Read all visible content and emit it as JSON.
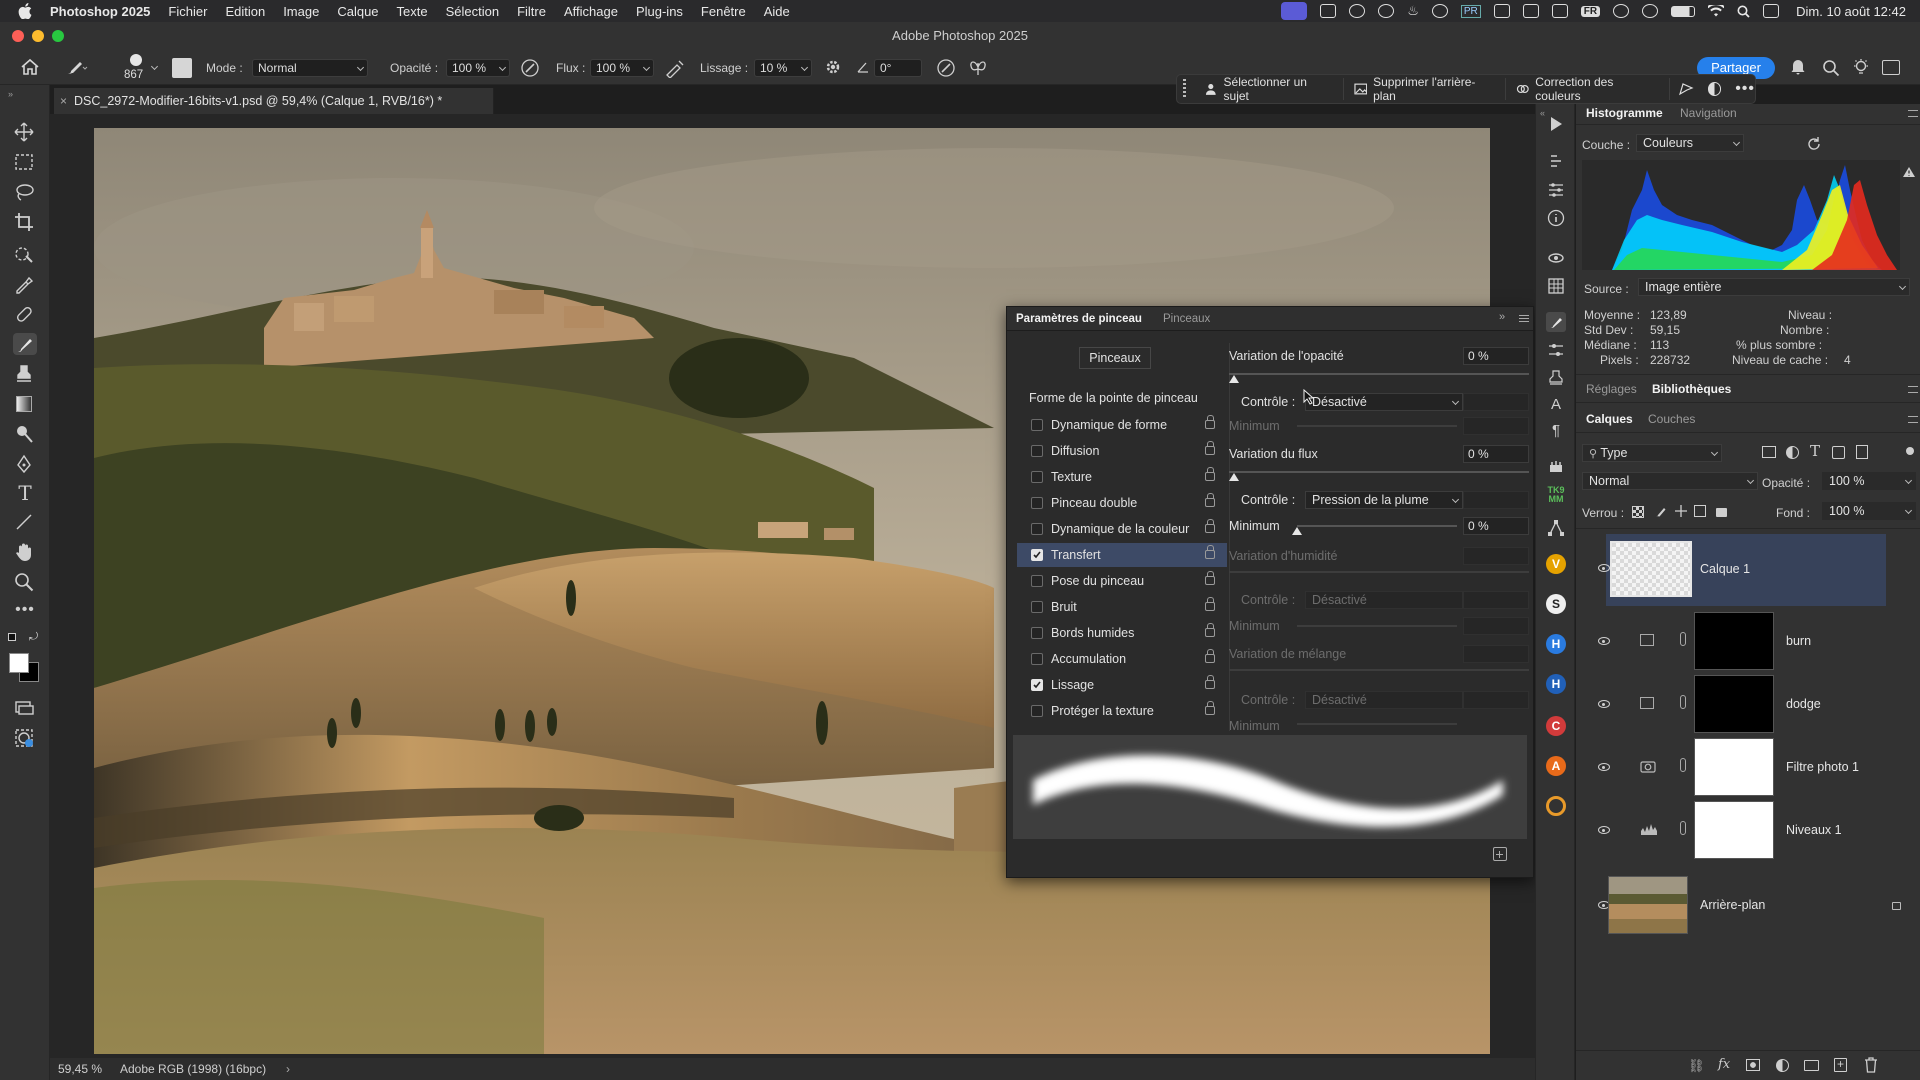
{
  "menubar": {
    "app": "Photoshop 2025",
    "items": [
      "Fichier",
      "Edition",
      "Image",
      "Calque",
      "Texte",
      "Sélection",
      "Filtre",
      "Affichage",
      "Plug-ins",
      "Fenêtre",
      "Aide"
    ],
    "input_lang": "FR",
    "datetime": "Dim. 10 août  12:42"
  },
  "window": {
    "title": "Adobe Photoshop 2025"
  },
  "options": {
    "brush_size": "867",
    "mode_label": "Mode :",
    "mode_value": "Normal",
    "opacity_label": "Opacité :",
    "opacity_value": "100 %",
    "flow_label": "Flux :",
    "flow_value": "100 %",
    "smoothing_label": "Lissage :",
    "smoothing_value": "10 %",
    "angle_value": "0°",
    "share_label": "Partager"
  },
  "contextual_bar": {
    "select_subject": "Sélectionner un sujet",
    "remove_bg": "Supprimer l'arrière-plan",
    "color_correction": "Correction des couleurs"
  },
  "document": {
    "tab_title": "DSC_2972-Modifier-16bits-v1.psd @ 59,4% (Calque 1, RVB/16*) *"
  },
  "status": {
    "zoom": "59,45 %",
    "profile": "Adobe RGB (1998) (16bpc)"
  },
  "histogram": {
    "tab_active": "Histogramme",
    "tab_other": "Navigation",
    "channel_label": "Couche :",
    "channel_value": "Couleurs",
    "source_label": "Source :",
    "source_value": "Image entière",
    "stats": {
      "mean_label": "Moyenne :",
      "mean": "123,89",
      "stddev_label": "Std Dev :",
      "stddev": "59,15",
      "median_label": "Médiane :",
      "median": "113",
      "pixels_label": "Pixels :",
      "pixels": "228732",
      "level_label": "Niveau :",
      "count_label": "Nombre :",
      "percentile_label": "% plus sombre :",
      "cache_label": "Niveau de cache :",
      "cache": "4"
    }
  },
  "adjust_tabs": {
    "reglages": "Réglages",
    "bibliotheques": "Bibliothèques"
  },
  "layers_panel": {
    "tab_active": "Calques",
    "tab_other": "Couches",
    "filter_type": "Type",
    "blend_mode": "Normal",
    "opacity_label": "Opacité :",
    "opacity_value": "100 %",
    "lock_label": "Verrou :",
    "fill_label": "Fond :",
    "fill_value": "100 %",
    "layers": [
      {
        "name": "Calque 1"
      },
      {
        "name": "burn"
      },
      {
        "name": "dodge"
      },
      {
        "name": "Filtre photo 1"
      },
      {
        "name": "Niveaux 1"
      },
      {
        "name": "Arrière-plan"
      }
    ]
  },
  "brush_settings": {
    "tab_active": "Paramètres de pinceau",
    "tab_other": "Pinceaux",
    "brushes_button": "Pinceaux",
    "tip_shape": "Forme de la pointe de pinceau",
    "items": [
      {
        "label": "Dynamique de forme",
        "checked": false
      },
      {
        "label": "Diffusion",
        "checked": false
      },
      {
        "label": "Texture",
        "checked": false
      },
      {
        "label": "Pinceau double",
        "checked": false
      },
      {
        "label": "Dynamique de la couleur",
        "checked": false
      },
      {
        "label": "Transfert",
        "checked": true
      },
      {
        "label": "Pose du pinceau",
        "checked": false
      },
      {
        "label": "Bruit",
        "checked": false
      },
      {
        "label": "Bords humides",
        "checked": false
      },
      {
        "label": "Accumulation",
        "checked": false
      },
      {
        "label": "Lissage",
        "checked": true
      },
      {
        "label": "Protéger la texture",
        "checked": false
      }
    ],
    "opacity_jitter_label": "Variation de l'opacité",
    "opacity_jitter_value": "0 %",
    "control_label": "Contrôle :",
    "control1_value": "Désactivé",
    "minimum_label": "Minimum",
    "flow_jitter_label": "Variation du flux",
    "flow_jitter_value": "0 %",
    "control2_value": "Pression de la plume",
    "minimum2_value": "0 %",
    "wetness_label": "Variation d'humidité",
    "control3_value": "Désactivé",
    "mix_label": "Variation de mélange",
    "control4_value": "Désactivé"
  }
}
